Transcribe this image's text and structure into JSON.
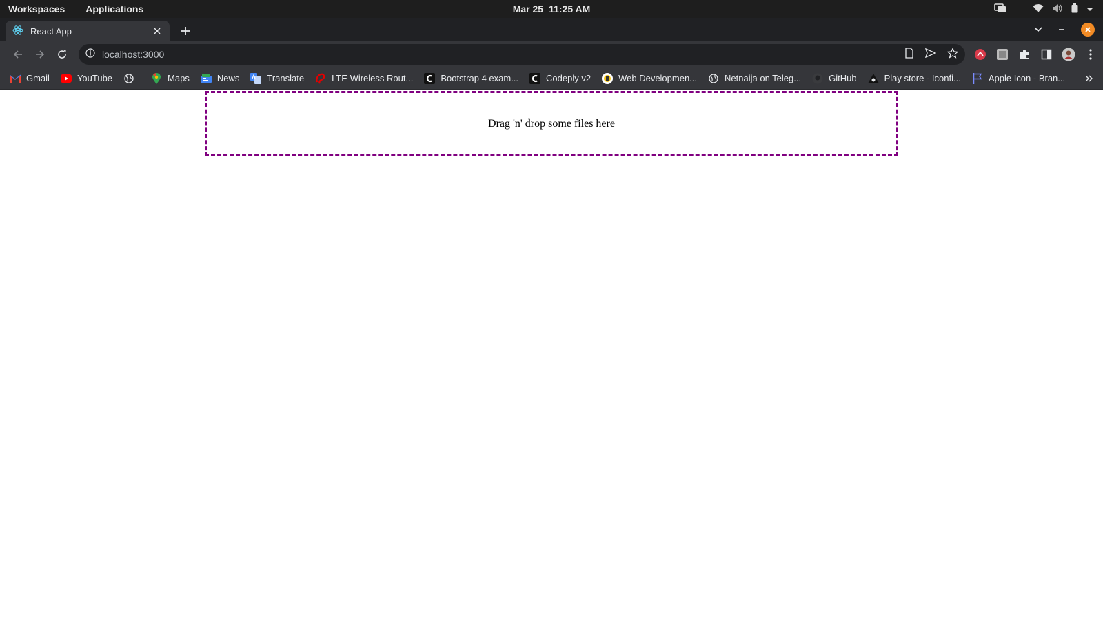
{
  "os": {
    "workspaces": "Workspaces",
    "applications": "Applications",
    "date": "Mar 25",
    "time": "11:25 AM"
  },
  "tab": {
    "title": "React App"
  },
  "address": {
    "url": "localhost:3000"
  },
  "bookmarks": [
    {
      "label": "Gmail"
    },
    {
      "label": "YouTube"
    },
    {
      "label": ""
    },
    {
      "label": "Maps"
    },
    {
      "label": "News"
    },
    {
      "label": "Translate"
    },
    {
      "label": "LTE Wireless Rout..."
    },
    {
      "label": "Bootstrap 4 exam..."
    },
    {
      "label": "Codeply v2"
    },
    {
      "label": "Web Developmen..."
    },
    {
      "label": "Netnaija on Teleg..."
    },
    {
      "label": "GitHub"
    },
    {
      "label": "Play store - Iconfi..."
    },
    {
      "label": "Apple Icon - Bran..."
    }
  ],
  "dropzone": {
    "text": "Drag 'n' drop some files here"
  },
  "colors": {
    "dropzone_border": "#800080",
    "window_close": "#f28b25"
  }
}
